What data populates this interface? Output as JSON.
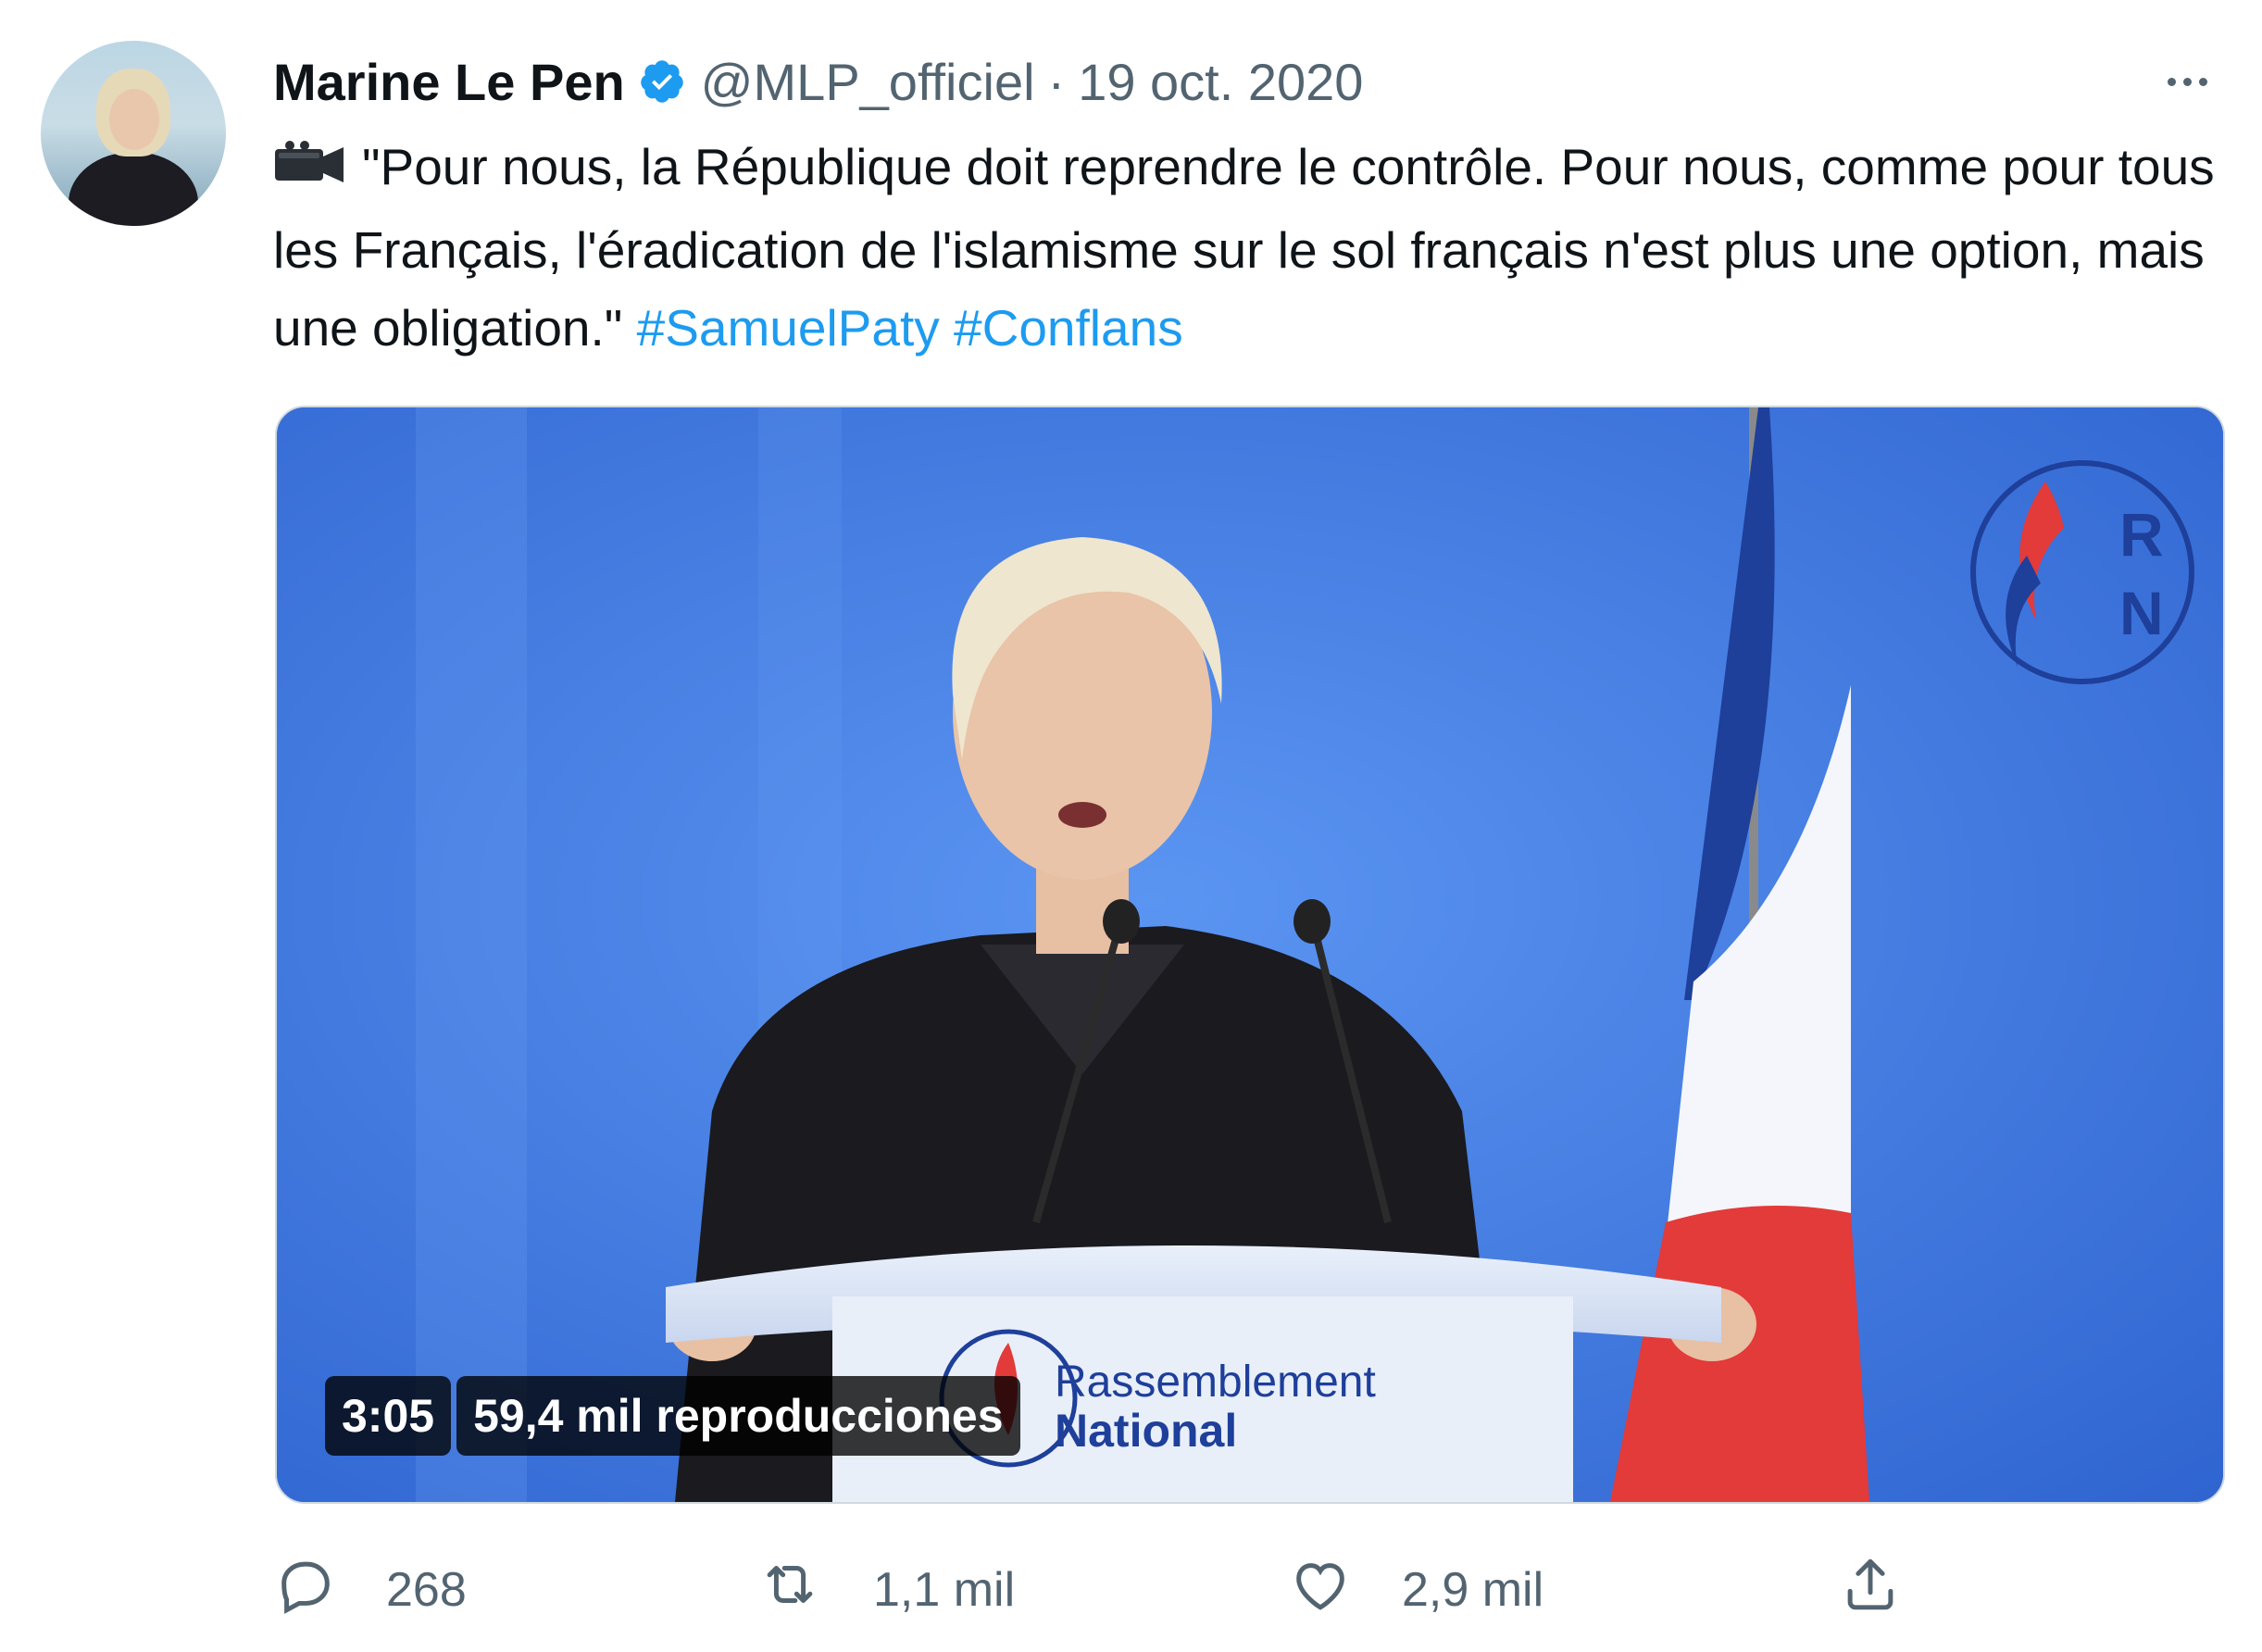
{
  "author": {
    "name": "Marine Le Pen",
    "handle": "@MLP_officiel",
    "separator": "·",
    "date": "19 oct. 2020"
  },
  "tweet": {
    "emoji": "📹",
    "body": "\"Pour nous, la République doit reprendre le contrôle. Pour nous, comme pour tous les Français, l'éradication de l'islamisme sur le sol français n'est plus une option, mais une obligation.\"",
    "hashtags": [
      "#SamuelPaty",
      "#Conflans"
    ]
  },
  "video": {
    "duration": "3:05",
    "views": "59,4 mil reproducciones",
    "logo_letters": [
      "R",
      "N"
    ],
    "podium_line1": "Rassemblement",
    "podium_line2": "National"
  },
  "actions": {
    "replies": "268",
    "retweets": "1,1 mil",
    "likes": "2,9 mil"
  },
  "colors": {
    "accent": "#1d9bf0",
    "secondary_text": "#536471",
    "primary_text": "#0f1419",
    "video_bg": "#3f7fe6"
  },
  "icons": [
    "verified-badge-icon",
    "more-options-icon",
    "video-camera-icon",
    "reply-icon",
    "retweet-icon",
    "like-icon",
    "share-icon"
  ]
}
